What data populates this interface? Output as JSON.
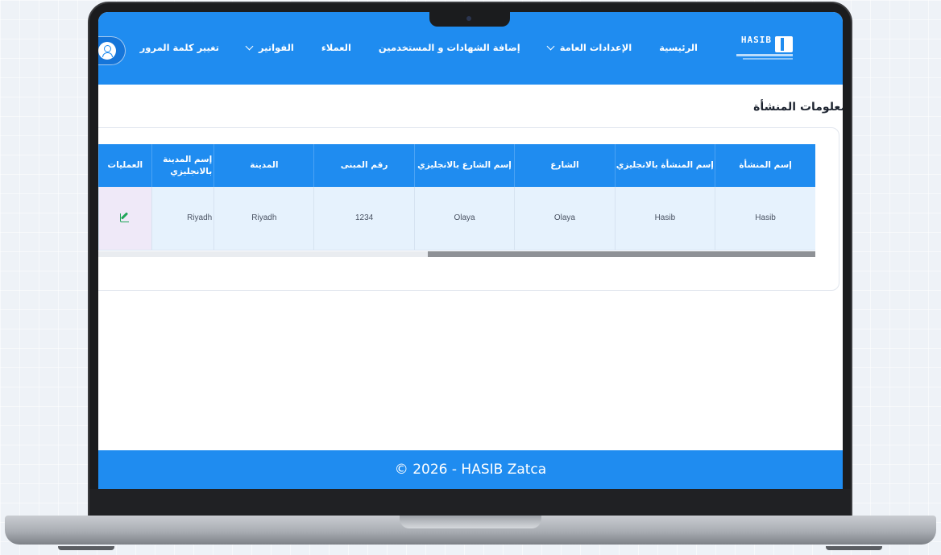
{
  "header": {
    "logo_text": "HASIB",
    "nav": [
      {
        "label": "الرئيسية",
        "dropdown": false
      },
      {
        "label": "الإعدادات العامة",
        "dropdown": true
      },
      {
        "label": "إضافة الشهادات و المستخدمين",
        "dropdown": false
      },
      {
        "label": "العملاء",
        "dropdown": false
      },
      {
        "label": "الفواتير",
        "dropdown": true
      },
      {
        "label": "تغيير كلمة المرور",
        "dropdown": false
      }
    ],
    "avatar_icon": "user-icon"
  },
  "page": {
    "title": "معلومات المنشأة"
  },
  "table": {
    "columns": [
      "إسم المنشأة",
      "إسم المنشأة بالانجليزي",
      "الشارع",
      "إسم الشارع بالانجليزي",
      "رقم المبنى",
      "المدينة",
      "إسم المدينة بالانجليزي",
      "العمليات"
    ],
    "rows": [
      [
        "Hasib",
        "Hasib",
        "Olaya",
        "Olaya",
        "1234",
        "Riyadh",
        "Riyadh",
        ""
      ]
    ],
    "action_icon": "edit-icon"
  },
  "footer": {
    "text": "© 2026 - HASIB Zatca"
  },
  "colors": {
    "primary": "#1f8cf0",
    "row_bg": "#e6f2fd",
    "edit_green": "#21a65a"
  }
}
